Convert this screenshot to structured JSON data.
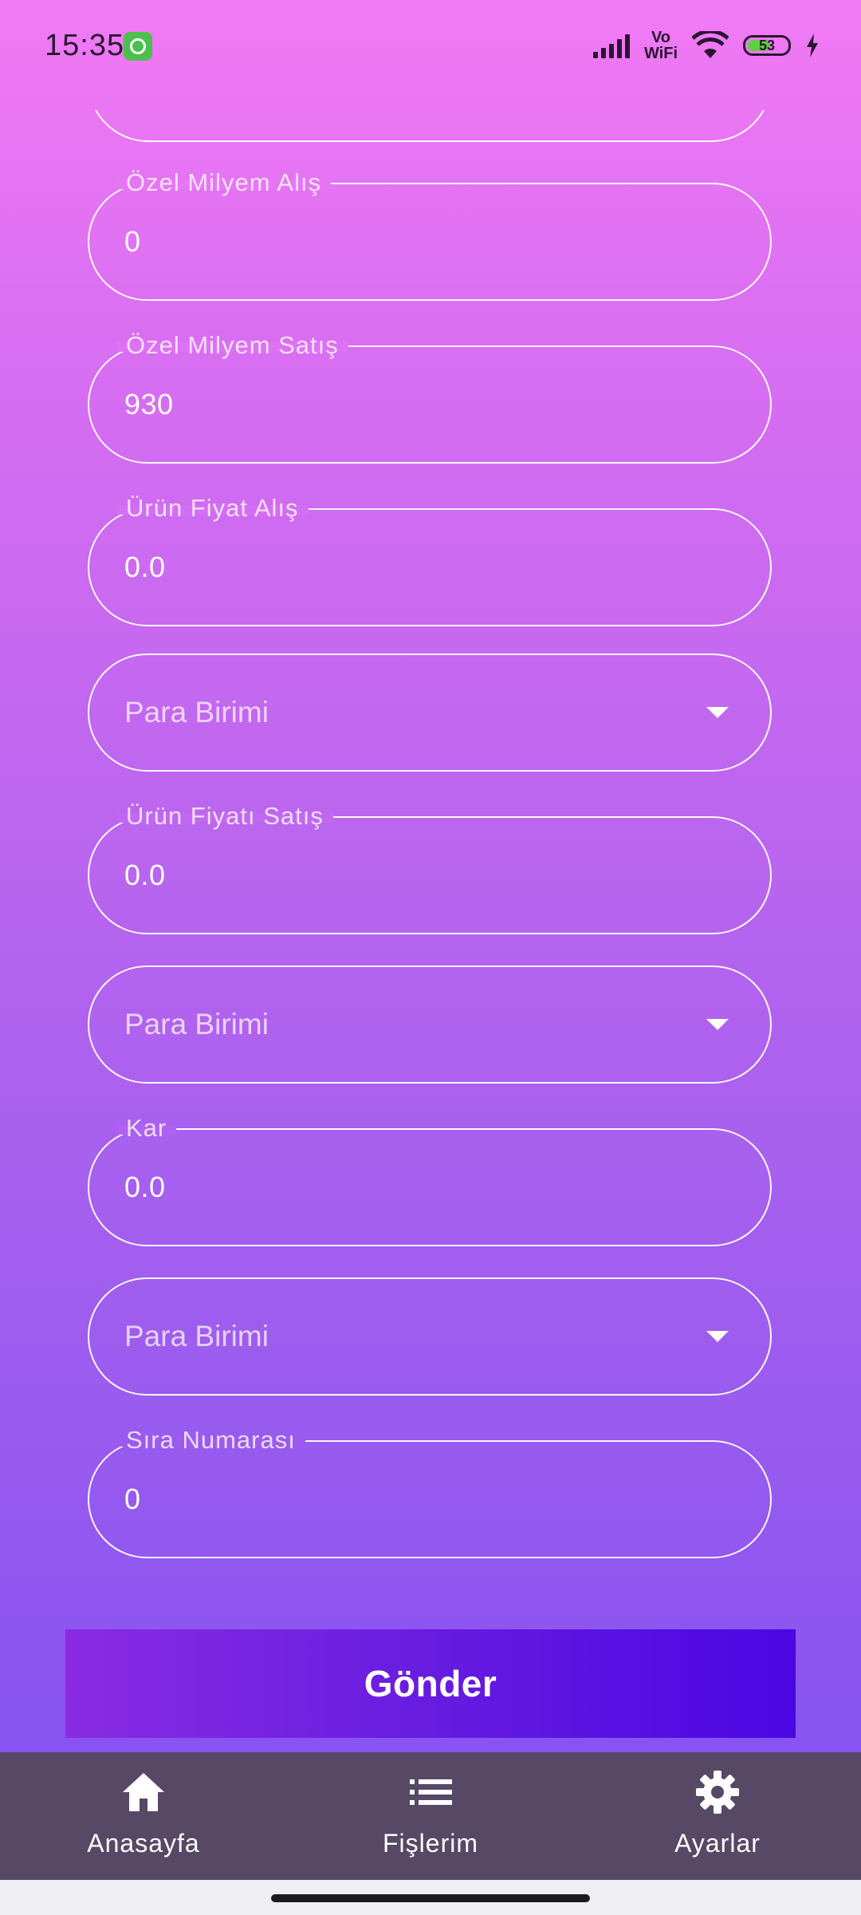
{
  "status_bar": {
    "time": "15:35",
    "vowifi_top": "Vo",
    "vowifi_bottom": "WiFi",
    "battery_level": "53"
  },
  "form": {
    "fields": [
      {
        "label": "Özel Milyem Alış",
        "value": "0"
      },
      {
        "label": "Özel Milyem Satış",
        "value": "930"
      },
      {
        "label": "Ürün Fiyat Alış",
        "value": "0.0"
      },
      {
        "placeholder": "Para Birimi"
      },
      {
        "label": "Ürün Fiyatı Satış",
        "value": "0.0"
      },
      {
        "placeholder": "Para Birimi"
      },
      {
        "label": "Kar",
        "value": "0.0"
      },
      {
        "placeholder": "Para Birimi"
      },
      {
        "label": "Sıra Numarası",
        "value": "0"
      }
    ],
    "submit_label": "Gönder"
  },
  "bottom_nav": {
    "items": [
      {
        "label": "Anasayfa",
        "icon": "home-icon"
      },
      {
        "label": "Fişlerim",
        "icon": "list-icon"
      },
      {
        "label": "Ayarlar",
        "icon": "gear-icon"
      }
    ]
  },
  "colors": {
    "gradient_top": "#f27af5",
    "gradient_bottom": "#7f4ff0",
    "button_start": "#8a2be2",
    "button_end": "#4a06e3",
    "nav_bg": "#574866"
  }
}
